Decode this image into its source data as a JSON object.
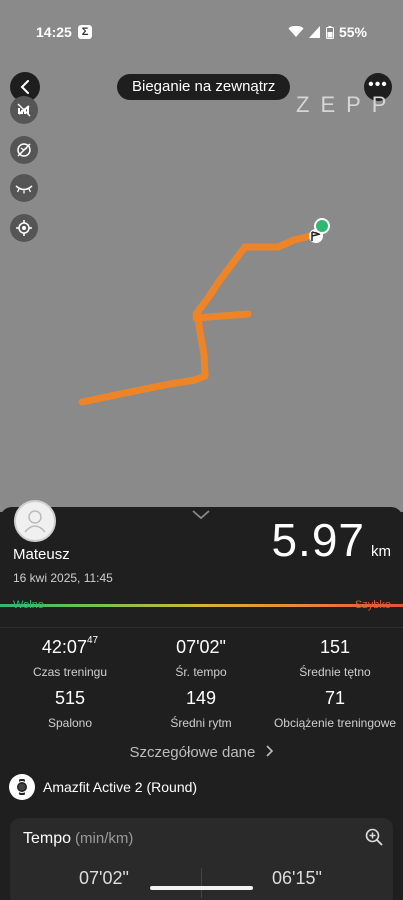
{
  "status": {
    "time": "14:25",
    "app_icon_glyph": "Σ",
    "battery": "55%"
  },
  "header": {
    "title": "Bieganie na zewnątrz",
    "brand": "ZEPP"
  },
  "map": {
    "tools": [
      "layers-off-icon",
      "hide-map-icon",
      "eye-closed-icon",
      "locate-icon"
    ],
    "route_color": "#f5841f",
    "background": "#8a8a8a"
  },
  "summary": {
    "user_name": "Mateusz",
    "datetime": "16 kwi 2025, 11:45",
    "distance_value": "5.97",
    "distance_unit": "km",
    "pace_slow_label": "Wolno",
    "pace_fast_label": "Szybko"
  },
  "stats": [
    {
      "value": "42:07",
      "value_sup": "47",
      "label": "Czas treningu"
    },
    {
      "value": "07'02\"",
      "label": "Śr. tempo"
    },
    {
      "value": "151",
      "label": "Średnie tętno"
    },
    {
      "value": "515",
      "label": "Spalono"
    },
    {
      "value": "149",
      "label": "Średni rytm"
    },
    {
      "value": "71",
      "label": "Obciążenie treningowe"
    }
  ],
  "details_link": "Szczegółowe dane",
  "device": {
    "name": "Amazfit Active 2 (Round)"
  },
  "tempo_card": {
    "title": "Tempo",
    "unit": "(min/km)",
    "value_1": "07'02\"",
    "value_2": "06'15\""
  }
}
